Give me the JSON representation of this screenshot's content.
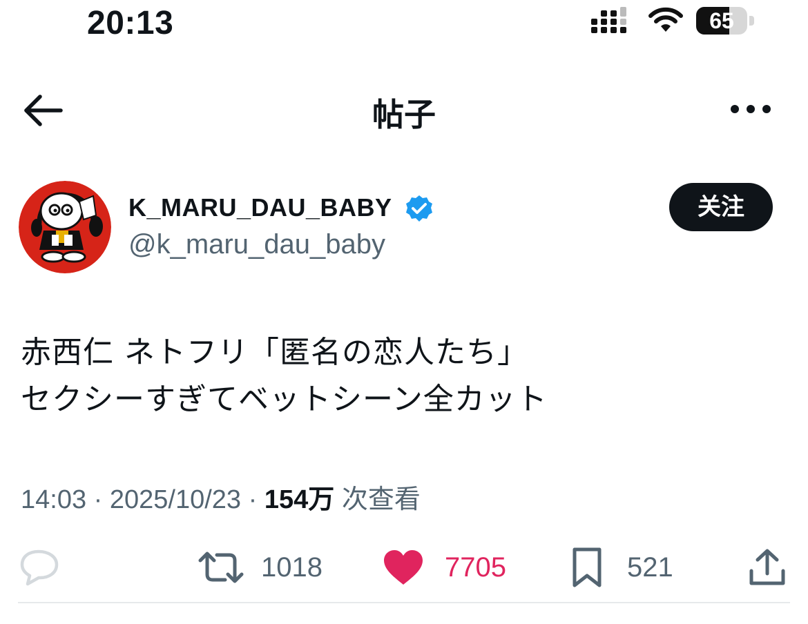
{
  "status_bar": {
    "time": "20:13",
    "battery_level": "65",
    "battery_fraction": 0.65,
    "signal_icon": "signal-bars-icon",
    "wifi_icon": "wifi-icon"
  },
  "header": {
    "title": "帖子",
    "back_icon": "arrow-left-icon",
    "more_icon": "ellipsis-icon"
  },
  "author": {
    "display_name": "K_MARU_DAU_BABY",
    "handle": "@k_maru_dau_baby",
    "verified": true,
    "follow_label": "关注",
    "avatar_colors": {
      "ring": "#d62418",
      "figure": "#111111"
    }
  },
  "tweet": {
    "lines": [
      "赤西仁 ネトフリ「匿名の恋人たち」",
      "セクシーすぎてベットシーン全カット"
    ]
  },
  "meta": {
    "time": "14:03",
    "separator": "·",
    "date": "2025/10/23",
    "views_count": "154万",
    "views_label": "次查看"
  },
  "actions": {
    "reply_count": "",
    "retweet_count": "1018",
    "like_count": "7705",
    "bookmark_count": "521",
    "liked": true
  },
  "colors": {
    "like": "#e0245e",
    "verified": "#1d9bf0",
    "text_secondary": "#536471",
    "text_primary": "#0f1419"
  }
}
